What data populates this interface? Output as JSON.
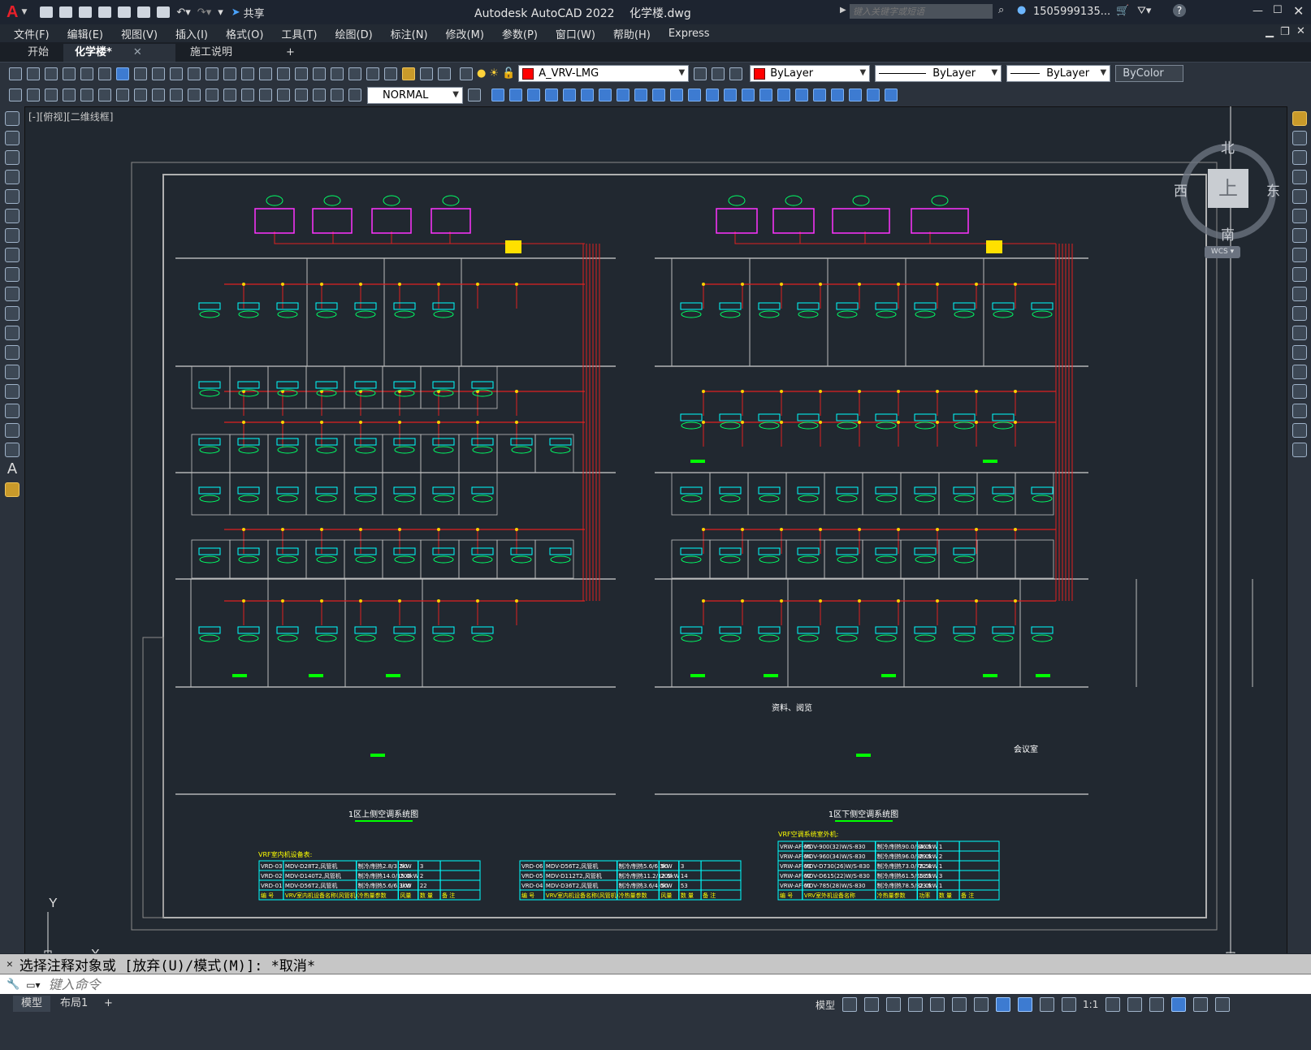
{
  "app": {
    "title": "Autodesk AutoCAD 2022",
    "file": "化学楼.dwg",
    "share": "共享"
  },
  "search": {
    "placeholder": "键入关键字或短语"
  },
  "user": {
    "name": "1505999135..."
  },
  "menu": [
    "文件(F)",
    "编辑(E)",
    "视图(V)",
    "插入(I)",
    "格式(O)",
    "工具(T)",
    "绘图(D)",
    "标注(N)",
    "修改(M)",
    "参数(P)",
    "窗口(W)",
    "帮助(H)",
    "Express"
  ],
  "tabs": [
    {
      "label": "开始",
      "closable": false
    },
    {
      "label": "化学楼*",
      "closable": true
    },
    {
      "label": "施工说明*",
      "closable": true
    }
  ],
  "toolbar": {
    "layer": "A_VRV-LMG",
    "color": "ByLayer",
    "linetype": "ByLayer",
    "lineweight": "ByLayer",
    "plotstyle": "ByColor",
    "dimstyle": "NORMAL",
    "layer_color": "#ff0000"
  },
  "viewport": {
    "label": "[-][俯视][二维线框]"
  },
  "viewcube": {
    "north": "北",
    "south": "南",
    "east": "东",
    "west": "西",
    "face": "上",
    "wcs": "WCS"
  },
  "ucs": {
    "x": "X",
    "y": "Y"
  },
  "drawing": {
    "title_left": "1区上侧空调系统图",
    "title_right": "1区下侧空调系统图",
    "label_mid": "资料、阅览",
    "label_meeting": "会议室",
    "table_left_title": "VRF室内机设备表:",
    "table_right_title": "VRF空调系统室外机:",
    "table_left_rows": [
      [
        "VRD-03",
        "MDV-D28T2,风管机",
        "制冷/制热2.8/3.2kW",
        "50",
        "3",
        ""
      ],
      [
        "VRD-02",
        "MDV-D140T2,风管机",
        "制冷/制热14.0/15.0kW",
        "200",
        "2",
        ""
      ],
      [
        "VRD-01",
        "MDV-D56T2,风管机",
        "制冷/制热5.6/6.3kW",
        "100",
        "22",
        ""
      ],
      [
        "编 号",
        "VRV室内机设备名称(风管机)",
        "冷热量参数",
        "风量",
        "数 量",
        "备 注"
      ]
    ],
    "table_mid_rows": [
      [
        "VRD-06",
        "MDV-D56T2,风管机",
        "制冷/制热5.6/6.3kW",
        "90",
        "3",
        ""
      ],
      [
        "VRD-05",
        "MDV-D112T2,风管机",
        "制冷/制热11.2/12.5kW",
        "200",
        "14",
        ""
      ],
      [
        "VRD-04",
        "MDV-D36T2,风管机",
        "制冷/制热3.6/4.0kW",
        "50",
        "53",
        ""
      ],
      [
        "编 号",
        "VRV室内机设备名称(风管机)",
        "冷热量参数",
        "风量",
        "数 量",
        "备 注"
      ]
    ],
    "table_right_rows": [
      [
        "VRW-AF-05",
        "MDV-900(32)W/S-830",
        "制冷/制热90.0/94.0kW",
        "26.5",
        "1",
        ""
      ],
      [
        "VRW-AF-04",
        "MDV-960(34)W/S-830",
        "制冷/制热96.0/98.0kW",
        "29.5",
        "2",
        ""
      ],
      [
        "VRW-AF-03",
        "MDV-D730(26)W/S-830",
        "制冷/制热73.0/78.5kW",
        "22.0",
        "1",
        ""
      ],
      [
        "VRW-AF-02",
        "MDV-D615(22)W/S-830",
        "制冷/制热61.5/65.5kW",
        "18.5",
        "3",
        ""
      ],
      [
        "VRW-AF-01",
        "MDV-785(28)W/S-830",
        "制冷/制热78.5/82.0kW",
        "23.5",
        "1",
        ""
      ],
      [
        "编 号",
        "VRV室外机设备名称",
        "冷热量参数",
        "功率",
        "数 量",
        "备 注"
      ]
    ]
  },
  "command": {
    "history": "选择注释对象或 [放弃(U)/模式(M)]: *取消*",
    "placeholder": "键入命令"
  },
  "status": {
    "model_tab": "模型",
    "layout_tab": "布局1",
    "add": "+",
    "model_btn": "模型",
    "scale": "1:1"
  }
}
